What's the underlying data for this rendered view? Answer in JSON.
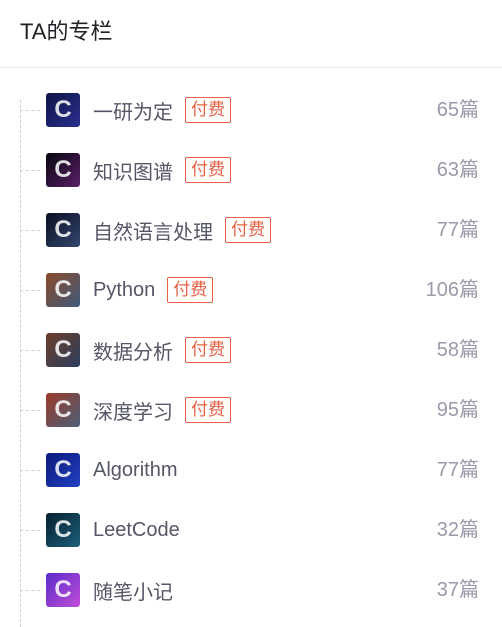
{
  "header": {
    "title": "TA的专栏"
  },
  "columns": [
    {
      "name": "一研为定",
      "tag": "付费",
      "count": "65篇",
      "thumb_colors": [
        "#0c1445",
        "#2b2f8f"
      ]
    },
    {
      "name": "知识图谱",
      "tag": "付费",
      "count": "63篇",
      "thumb_colors": [
        "#06060c",
        "#5a1f6a"
      ]
    },
    {
      "name": "自然语言处理",
      "tag": "付费",
      "count": "77篇",
      "thumb_colors": [
        "#0a0f22",
        "#33466e"
      ]
    },
    {
      "name": "Python",
      "tag": "付费",
      "count": "106篇",
      "thumb_colors": [
        "#8a4a2a",
        "#3e5b7c"
      ]
    },
    {
      "name": "数据分析",
      "tag": "付费",
      "count": "58篇",
      "thumb_colors": [
        "#6b3d2b",
        "#2c3e5f"
      ]
    },
    {
      "name": "深度学习",
      "tag": "付费",
      "count": "95篇",
      "thumb_colors": [
        "#9a3a2a",
        "#4a6078"
      ]
    },
    {
      "name": "Algorithm",
      "tag": "",
      "count": "77篇",
      "thumb_colors": [
        "#0a1a7a",
        "#2240c0"
      ]
    },
    {
      "name": "LeetCode",
      "tag": "",
      "count": "32篇",
      "thumb_colors": [
        "#062030",
        "#1d5f7a"
      ]
    },
    {
      "name": "随笔小记",
      "tag": "",
      "count": "37篇",
      "thumb_colors": [
        "#5b2bc8",
        "#c04ed8"
      ]
    }
  ]
}
